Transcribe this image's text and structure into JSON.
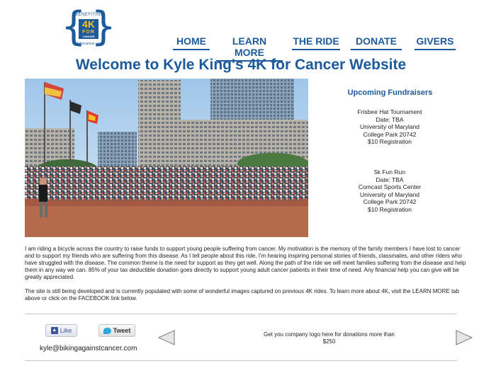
{
  "logo": {
    "benefiting": "BENEFITING",
    "big": "4K",
    "for": "FOR",
    "cancer": "CANCER",
    "url": "4kforcancer.org"
  },
  "nav": {
    "items": [
      "HOME",
      "LEARN MORE",
      "THE RIDE",
      "DONATE",
      "GIVERS"
    ]
  },
  "page_title": "Welcome to Kyle King's 4K for Cancer Website",
  "sidebar": {
    "title": "Upcoming Fundraisers",
    "events": [
      {
        "lines": [
          "Frisbee Hat Tournament",
          "Date: TBA",
          "University of Maryland",
          "College Park 20742",
          "$10 Registration"
        ]
      },
      {
        "lines": [
          "5k Fun Run",
          "Date: TBA",
          "Comcast Sports Center",
          "University of Maryland",
          "College Park 20742",
          "$10 Registration"
        ]
      }
    ]
  },
  "content": {
    "paragraph1": "I am riding a bicycle across the country to raise funds to support young people suffering from cancer.  My motivation is the memory of the family members I have lost to cancer and to support my friends who are suffering from this disease.  As I tell people about this ride, I'm hearing inspiring personal stories of friends, classmates, and other riders who have struggled with the disease.  The common theme is the need for support as they get well.  Along the path of the ride we will meet families suffering from the disease and help them in any way we can.   85% of your tax deductible donation goes directly to support young adult cancer patients in their time of need.  Any financial help you can give will be greatly appreciated.",
    "paragraph2": "The site is still being developed and is currently populated with some of wonderful images captured on previous 4K rides. To learn more about 4K, visit the LEARN MORE tab above or click on the FACEBOOK link below."
  },
  "footer": {
    "like_label": "Like",
    "tweet_label": "Tweet",
    "email": "kyle@bikingagainstcancer.com",
    "sponsor_text": "Get you company logo here for donations more than $250"
  },
  "colors": {
    "brand_blue": "#1d5a9c",
    "logo_yellow": "#f2c31b"
  }
}
